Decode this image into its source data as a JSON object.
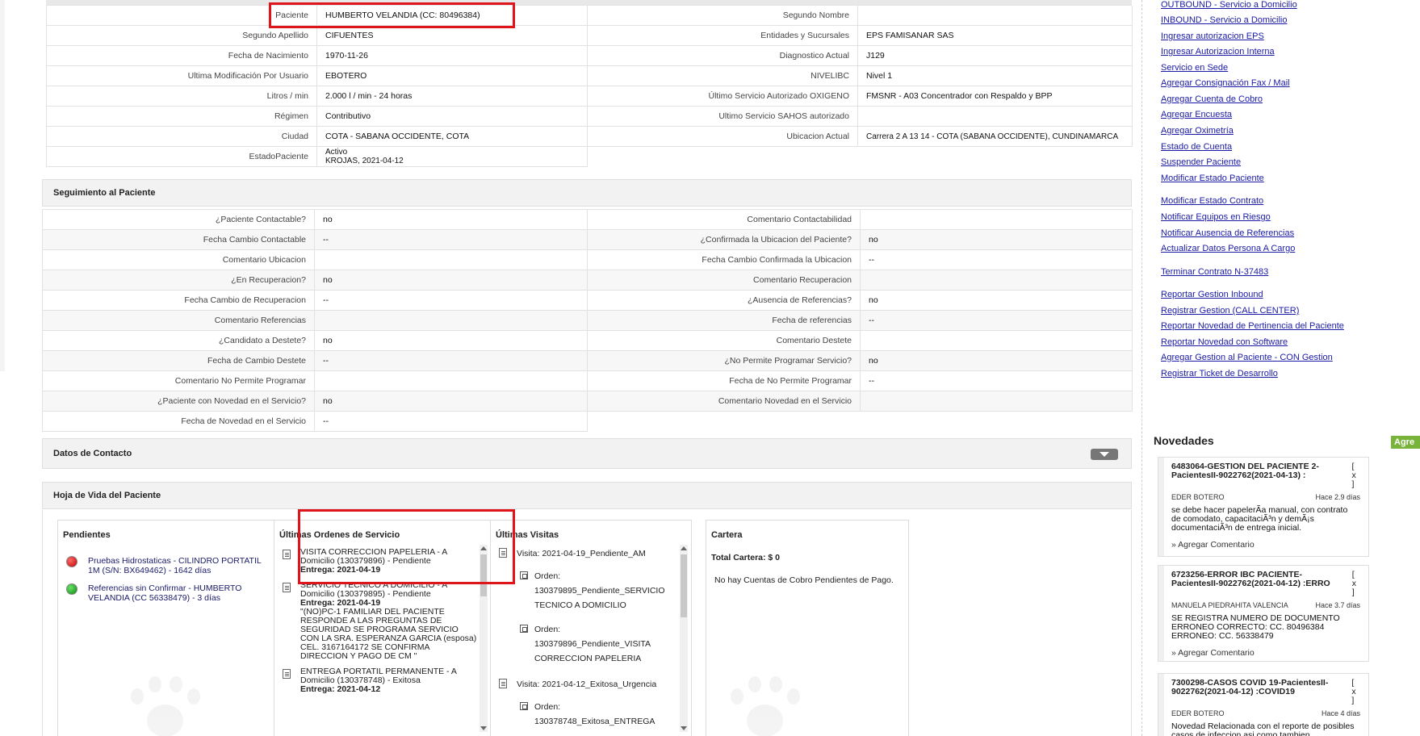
{
  "patient_info": {
    "rows": [
      {
        "l1": "Paciente",
        "v1": "HUMBERTO VELANDIA (CC: 80496384)",
        "l2": "Segundo Nombre",
        "v2": ""
      },
      {
        "l1": "Segundo Apellido",
        "v1": "CIFUENTES",
        "l2": "Entidades y Sucursales",
        "v2": "EPS FAMISANAR SAS"
      },
      {
        "l1": "Fecha de Nacimiento",
        "v1": "1970-11-26",
        "l2": "Diagnostico Actual",
        "v2": "J129"
      },
      {
        "l1": "Ultima Modificación Por Usuario",
        "v1": "EBOTERO",
        "l2": "NIVELIBC",
        "v2": "Nivel 1"
      },
      {
        "l1": "Litros / min",
        "v1": "2.000 l / min - 24 horas",
        "l2": "Último Servicio Autorizado OXIGENO",
        "v2": "FMSNR - A03 Concentrador con Respaldo y BPP"
      },
      {
        "l1": "Régimen",
        "v1": "Contributivo",
        "l2": "Ultimo Servicio SAHOS autorizado",
        "v2": ""
      },
      {
        "l1": "Ciudad",
        "v1": "COTA - SABANA OCCIDENTE, COTA",
        "l2": "Ubicacion Actual",
        "v2": "Carrera 2 A 13 14 - COTA (SABANA OCCIDENTE), CUNDINAMARCA"
      }
    ],
    "estado_label": "EstadoPaciente",
    "estado_value_1": "Activo",
    "estado_value_2": "KROJAS, 2021-04-12"
  },
  "seguimiento": {
    "title": "Seguimiento al Paciente",
    "rows": [
      {
        "l1": "¿Paciente Contactable?",
        "v1": "no",
        "l2": "Comentario Contactabilidad",
        "v2": ""
      },
      {
        "l1": "Fecha Cambio Contactable",
        "v1": "--",
        "l2": "¿Confirmada la Ubicacion del Paciente?",
        "v2": "no"
      },
      {
        "l1": "Comentario Ubicacion",
        "v1": "",
        "l2": "Fecha Cambio Confirmada la Ubicacion",
        "v2": "--"
      },
      {
        "l1": "¿En Recuperacion?",
        "v1": "no",
        "l2": "Comentario Recuperacion",
        "v2": ""
      },
      {
        "l1": "Fecha Cambio de Recuperacion",
        "v1": "--",
        "l2": "¿Ausencia de Referencias?",
        "v2": "no"
      },
      {
        "l1": "Comentario Referencias",
        "v1": "",
        "l2": "Fecha de referencias",
        "v2": "--"
      },
      {
        "l1": "¿Candidato a Destete?",
        "v1": "no",
        "l2": "Comentario Destete",
        "v2": ""
      },
      {
        "l1": "Fecha de Cambio Destete",
        "v1": "--",
        "l2": "¿No Permite Programar Servicio?",
        "v2": "no"
      },
      {
        "l1": "Comentario No Permite Programar",
        "v1": "",
        "l2": "Fecha de No Permite Programar",
        "v2": "--"
      },
      {
        "l1": "¿Paciente con Novedad en el Servicio?",
        "v1": "no",
        "l2": "Comentario Novedad en el Servicio",
        "v2": ""
      }
    ],
    "last_label": "Fecha de Novedad en el Servicio",
    "last_value": "--"
  },
  "contacto": {
    "title": "Datos de Contacto"
  },
  "hoja": {
    "title": "Hoja de Vida del Paciente",
    "pendientes": {
      "title": "Pendientes",
      "items": [
        {
          "text": "Pruebas Hidrostaticas - CILINDRO PORTATIL 1M (S/N: BX649462) - 1642 días",
          "status_color": "#d00000"
        },
        {
          "text": "Referencias sin Confirmar - HUMBERTO VELANDIA (CC 56338479) - 3 días",
          "status_color": "#0a8a0a"
        }
      ]
    },
    "ordenes": {
      "title": "Últimas Ordenes de Servicio",
      "items": [
        {
          "text": "VISITA CORRECCION PAPELERIA - A Domicilio (130379896) - Pendiente",
          "entrega": "Entrega: 2021-04-19",
          "note": ""
        },
        {
          "text": "SERVICIO TECNICO A DOMICILIO - A Domicilio (130379895) - Pendiente",
          "entrega": "Entrega: 2021-04-19",
          "note": "\"(NO)PC-1 FAMILIAR DEL PACIENTE RESPONDE A LAS PREGUNTAS DE SEGURIDAD SE PROGRAMA SERVICIO CON LA SRA. ESPERANZA GARCIA (esposa) CEL. 3167164172 SE CONFIRMA DIRECCION Y PAGO DE CM \""
        },
        {
          "text": "ENTREGA PORTATIL PERMANENTE - A Domicilio (130378748) - Exitosa",
          "entrega": "Entrega: 2021-04-12",
          "note": ""
        }
      ]
    },
    "visitas": {
      "title": "Últimas Visitas",
      "visit1": "Visita: 2021-04-19_Pendiente_AM",
      "orden1a": "Orden: 130379895_Pendiente_SERVICIO TECNICO A DOMICILIO",
      "orden1b": "Orden: 130379896_Pendiente_VISITA CORRECCION PAPELERIA",
      "visit2": "Visita: 2021-04-12_Exitosa_Urgencia",
      "orden2a": "Orden: 130378748_Exitosa_ENTREGA"
    },
    "cartera": {
      "title": "Cartera",
      "total": "Total Cartera: $ 0",
      "note": "No hay Cuentas de Cobro Pendientes de Pago."
    }
  },
  "sidebar": {
    "links": [
      "OUTBOUND - Servicio a Domicilio",
      "INBOUND - Servicio a Domicilio",
      "Ingresar autorizacion EPS",
      "Ingresar Autorizacion Interna",
      "Servicio en Sede",
      "Agregar Consignación Fax / Mail",
      "Agregar Cuenta de Cobro",
      "Agregar Encuesta",
      "Agregar Oximetría",
      "Estado de Cuenta",
      "Suspender Paciente",
      "Modificar Estado Paciente",
      "Modificar Estado Contrato",
      "Notificar Equipos en Riesgo",
      "Notificar Ausencia de Referencias",
      "Actualizar Datos Persona A Cargo",
      "Terminar Contrato N-37483",
      "Reportar Gestion Inbound",
      "Registrar Gestion (CALL CENTER)",
      "Reportar Novedad de Pertinencia del Paciente",
      "Reportar Novedad con Software",
      "Agregar Gestion al Paciente - CON Gestion",
      "Registrar Ticket de Desarrollo"
    ],
    "novedades_title": "Novedades",
    "agregar_btn": "Agre",
    "close_label": "[ x ]",
    "add_comment": "» Agregar Comentario",
    "novedades": [
      {
        "title": "6483064-GESTION DEL PACIENTE 2-PacientesII-9022762(2021-04-13) :",
        "user": "EDER BOTERO",
        "ago": "Hace 2.9 días",
        "body": "se debe hacer papelerÃa manual, con contrato de comodato, capacitaciÃ³n y demÃ¡s documentaciÃ³n de entrega inicial."
      },
      {
        "title": "6723256-ERROR IBC PACIENTE-PacientesII-9022762(2021-04-12) :ERRO",
        "user": "MANUELA PIEDRAHITA VALENCIA",
        "ago": "Hace 3.7 días",
        "body": "SE REGISTRA NUMERO DE DOCUMENTO ERRONEO CORRECTO: CC. 80496384 ERRONEO: CC. 56338479"
      },
      {
        "title": "7300298-CASOS COVID 19-PacientesII-9022762(2021-04-12) :COVID19",
        "user": "EDER BOTERO",
        "ago": "Hace 4 días",
        "body": "Novedad Relacionada con el reporte de posibles casos de infeccion asi como tambien"
      }
    ]
  }
}
